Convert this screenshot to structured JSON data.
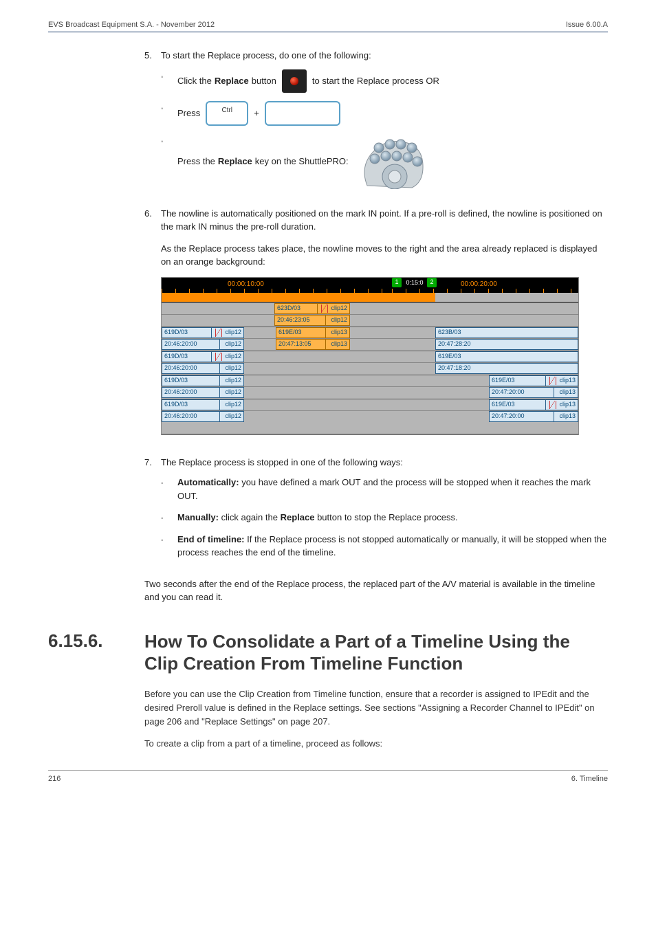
{
  "header": {
    "left": "EVS Broadcast Equipment S.A.  - November 2012",
    "right": "Issue 6.00.A"
  },
  "step5": {
    "num": "5.",
    "text": "To start the Replace process, do one of the following:",
    "items": {
      "a_pre": "Click the ",
      "a_bold": "Replace",
      "a_mid": " button ",
      "a_post": " to start the Replace process OR",
      "b_pre": "Press ",
      "b_plus": " + ",
      "ctrl": "Ctrl",
      "c_pre": "Press the ",
      "c_bold": "Replace",
      "c_post": " key on the ShuttlePRO: "
    }
  },
  "step6": {
    "num": "6.",
    "p1": "The nowline is automatically positioned on the mark IN point. If a pre-roll is defined, the nowline is positioned on the mark IN minus the pre-roll duration.",
    "p2": "As the Replace process takes place, the nowline moves to the right and the area already replaced is displayed on an orange background:"
  },
  "timeline": {
    "ruler_left": "00:00:10:00",
    "ruler_between": "0:15:0",
    "ruler_right": "00:00:20:00",
    "m1": "1",
    "m2": "2",
    "row1": {
      "left_none": true,
      "orange_name": "623D/03",
      "orange_tag": "clip12",
      "orange_name2": "20:46:23:05",
      "orange_tag2": "clip12"
    },
    "row2": {
      "l_name": "619D/03",
      "l_tag": "clip12",
      "l_name2": "20:46:20:00",
      "l_tag2": "clip12",
      "o_name": "619E/03",
      "o_tag": "clip13",
      "o_name2": "20:47:13:05",
      "o_tag2": "clip13",
      "r_name": "623B/03",
      "r_name2": "20:47:28:20"
    },
    "row3": {
      "l_name": "619D/03",
      "l_tag": "clip12",
      "l_name2": "20:46:20:00",
      "l_tag2": "clip12",
      "r_name": "619E/03",
      "r_name2": "20:47:18:20"
    },
    "row4": {
      "l_name": "619D/03",
      "l_tag": "clip12",
      "l_name2": "20:46:20:00",
      "l_tag2": "clip12",
      "r_name": "619E/03",
      "r_tag": "clip13",
      "r_name2": "20:47:20:00",
      "r_tag2": "clip13"
    },
    "row5": {
      "l_name": "619D/03",
      "l_tag": "clip12",
      "l_name2": "20:46:20:00",
      "l_tag2": "clip12",
      "r_name": "619E/03",
      "r_tag": "clip13",
      "r_name2": "20:47:20:00",
      "r_tag2": "clip13"
    }
  },
  "step7": {
    "num": "7.",
    "text": "The Replace process is stopped in one of the following ways:",
    "a_bold": "Automatically:",
    "a_rest": " you have defined a mark OUT and the process will be stopped when it reaches the mark OUT.",
    "b_bold": "Manually:",
    "b_rest_pre": " click again the ",
    "b_rest_bold": "Replace",
    "b_rest_post": " button to stop the Replace process.",
    "c_bold": "End of timeline:",
    "c_rest": " If the Replace process is not stopped automatically or manually, it will be stopped when the process reaches the end of the timeline."
  },
  "after7": "Two seconds after the end of the Replace process, the replaced part of the A/V material is available in the timeline and you can read it.",
  "section": {
    "num": "6.15.6.",
    "title": "How To Consolidate a Part of a Timeline Using the Clip Creation From Timeline Function"
  },
  "body": {
    "p1": "Before you can use the Clip Creation from Timeline function, ensure that a recorder is assigned to IPEdit and the desired Preroll value is defined in the Replace settings. See sections \"Assigning a Recorder Channel to IPEdit\" on page 206 and \"Replace Settings\" on page 207.",
    "p2": "To create a clip from a part of a timeline, proceed as follows:"
  },
  "footer": {
    "left": "216",
    "right": "6. Timeline"
  }
}
